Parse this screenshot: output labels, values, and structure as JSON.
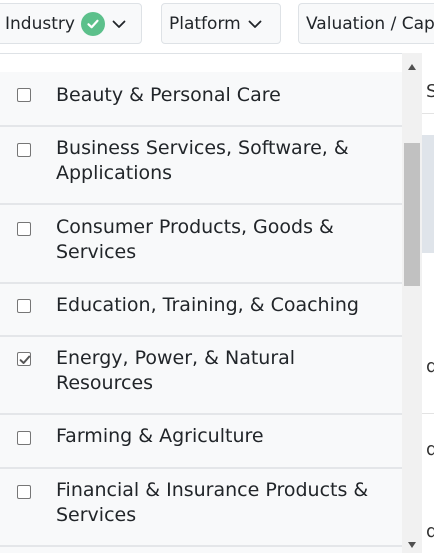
{
  "filters": {
    "industry_label": "Industry",
    "platform_label": "Platform",
    "valuation_label": "Valuation / Cap"
  },
  "industry_options": [
    {
      "label": "Beauty & Personal Care",
      "checked": false
    },
    {
      "label": "Business Services, Software, & Applications",
      "checked": false
    },
    {
      "label": "Consumer Products, Goods & Services",
      "checked": false
    },
    {
      "label": "Education, Training, & Coaching",
      "checked": false
    },
    {
      "label": "Energy, Power, & Natural Resources",
      "checked": true
    },
    {
      "label": "Farming & Agriculture",
      "checked": false
    },
    {
      "label": "Financial & Insurance Products & Services",
      "checked": false
    }
  ],
  "background_fragments": {
    "t1": "S",
    "t2": "d",
    "t3": "d",
    "t4": "d"
  },
  "colors": {
    "applied_badge": "#5cc08b",
    "row_background": "#f8f9fa",
    "scroll_thumb": "#c1c1c1"
  }
}
